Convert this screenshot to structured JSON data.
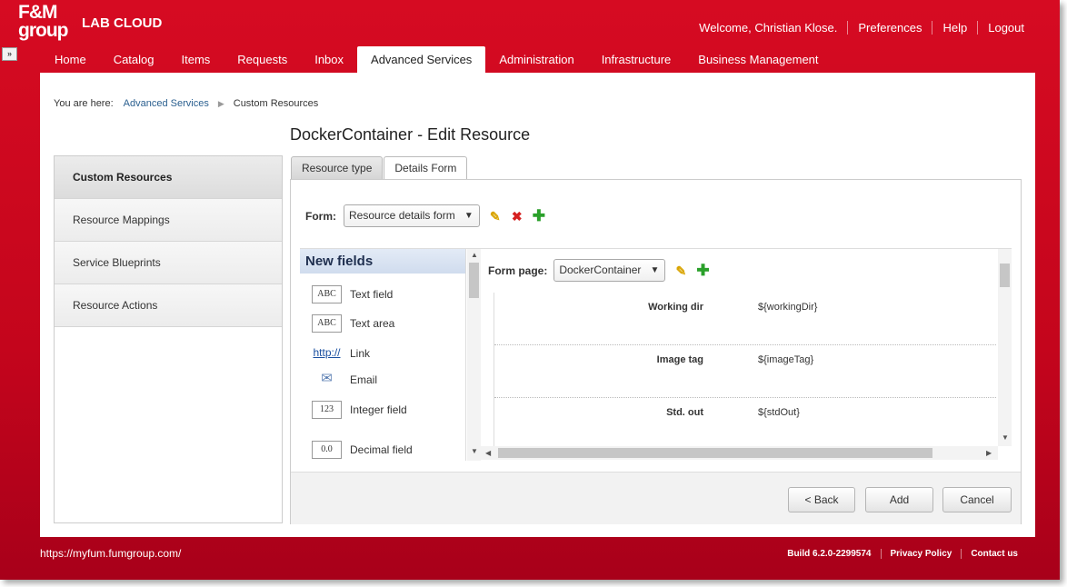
{
  "header": {
    "logo_line1": "F&M",
    "logo_line2": "group",
    "app_title": "LAB CLOUD",
    "expand_glyph": "»",
    "links": [
      "Welcome, Christian Klose.",
      "Preferences",
      "Help",
      "Logout"
    ]
  },
  "nav": {
    "tabs": [
      "Home",
      "Catalog",
      "Items",
      "Requests",
      "Inbox",
      "Advanced Services",
      "Administration",
      "Infrastructure",
      "Business Management"
    ],
    "active": "Advanced Services"
  },
  "breadcrumb": {
    "prefix": "You are here:",
    "items": [
      "Advanced Services",
      "Custom Resources"
    ]
  },
  "page": {
    "title": "DockerContainer - Edit Resource"
  },
  "sidebar": {
    "items": [
      "Custom Resources",
      "Resource Mappings",
      "Service Blueprints",
      "Resource Actions"
    ],
    "active": "Custom Resources"
  },
  "tabs": [
    "Resource type",
    "Details Form"
  ],
  "form": {
    "label": "Form:",
    "selected": "Resource details form"
  },
  "new_fields": {
    "title": "New fields",
    "items": [
      {
        "icon_text": "ABC",
        "label": "Text field"
      },
      {
        "icon_text": "ABC",
        "label": "Text area"
      },
      {
        "icon_text": "http://",
        "label": "Link"
      },
      {
        "icon_text": "✉",
        "label": "Email"
      },
      {
        "icon_text": "123",
        "label": "Integer field"
      },
      {
        "icon_text": "0.0",
        "label": "Decimal field"
      }
    ]
  },
  "form_page": {
    "label": "Form page:",
    "selected": "DockerContainer",
    "fields": [
      {
        "label": "Working dir",
        "value": "${workingDir}"
      },
      {
        "label": "Image tag",
        "value": "${imageTag}"
      },
      {
        "label": "Std. out",
        "value": "${stdOut}"
      }
    ]
  },
  "buttons": {
    "back": "< Back",
    "add": "Add",
    "cancel": "Cancel"
  },
  "footer": {
    "url": "https://myfum.fumgroup.com/",
    "build": "Build 6.2.0-2299574",
    "privacy": "Privacy Policy",
    "contact": "Contact us"
  }
}
